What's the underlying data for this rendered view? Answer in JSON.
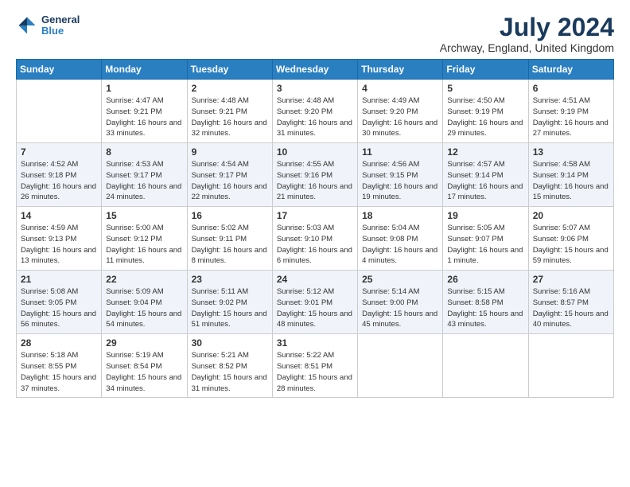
{
  "logo": {
    "line1": "General",
    "line2": "Blue"
  },
  "title": "July 2024",
  "subtitle": "Archway, England, United Kingdom",
  "weekdays": [
    "Sunday",
    "Monday",
    "Tuesday",
    "Wednesday",
    "Thursday",
    "Friday",
    "Saturday"
  ],
  "weeks": [
    [
      {
        "day": "",
        "sunrise": "",
        "sunset": "",
        "daylight": ""
      },
      {
        "day": "1",
        "sunrise": "Sunrise: 4:47 AM",
        "sunset": "Sunset: 9:21 PM",
        "daylight": "Daylight: 16 hours and 33 minutes."
      },
      {
        "day": "2",
        "sunrise": "Sunrise: 4:48 AM",
        "sunset": "Sunset: 9:21 PM",
        "daylight": "Daylight: 16 hours and 32 minutes."
      },
      {
        "day": "3",
        "sunrise": "Sunrise: 4:48 AM",
        "sunset": "Sunset: 9:20 PM",
        "daylight": "Daylight: 16 hours and 31 minutes."
      },
      {
        "day": "4",
        "sunrise": "Sunrise: 4:49 AM",
        "sunset": "Sunset: 9:20 PM",
        "daylight": "Daylight: 16 hours and 30 minutes."
      },
      {
        "day": "5",
        "sunrise": "Sunrise: 4:50 AM",
        "sunset": "Sunset: 9:19 PM",
        "daylight": "Daylight: 16 hours and 29 minutes."
      },
      {
        "day": "6",
        "sunrise": "Sunrise: 4:51 AM",
        "sunset": "Sunset: 9:19 PM",
        "daylight": "Daylight: 16 hours and 27 minutes."
      }
    ],
    [
      {
        "day": "7",
        "sunrise": "Sunrise: 4:52 AM",
        "sunset": "Sunset: 9:18 PM",
        "daylight": "Daylight: 16 hours and 26 minutes."
      },
      {
        "day": "8",
        "sunrise": "Sunrise: 4:53 AM",
        "sunset": "Sunset: 9:17 PM",
        "daylight": "Daylight: 16 hours and 24 minutes."
      },
      {
        "day": "9",
        "sunrise": "Sunrise: 4:54 AM",
        "sunset": "Sunset: 9:17 PM",
        "daylight": "Daylight: 16 hours and 22 minutes."
      },
      {
        "day": "10",
        "sunrise": "Sunrise: 4:55 AM",
        "sunset": "Sunset: 9:16 PM",
        "daylight": "Daylight: 16 hours and 21 minutes."
      },
      {
        "day": "11",
        "sunrise": "Sunrise: 4:56 AM",
        "sunset": "Sunset: 9:15 PM",
        "daylight": "Daylight: 16 hours and 19 minutes."
      },
      {
        "day": "12",
        "sunrise": "Sunrise: 4:57 AM",
        "sunset": "Sunset: 9:14 PM",
        "daylight": "Daylight: 16 hours and 17 minutes."
      },
      {
        "day": "13",
        "sunrise": "Sunrise: 4:58 AM",
        "sunset": "Sunset: 9:14 PM",
        "daylight": "Daylight: 16 hours and 15 minutes."
      }
    ],
    [
      {
        "day": "14",
        "sunrise": "Sunrise: 4:59 AM",
        "sunset": "Sunset: 9:13 PM",
        "daylight": "Daylight: 16 hours and 13 minutes."
      },
      {
        "day": "15",
        "sunrise": "Sunrise: 5:00 AM",
        "sunset": "Sunset: 9:12 PM",
        "daylight": "Daylight: 16 hours and 11 minutes."
      },
      {
        "day": "16",
        "sunrise": "Sunrise: 5:02 AM",
        "sunset": "Sunset: 9:11 PM",
        "daylight": "Daylight: 16 hours and 8 minutes."
      },
      {
        "day": "17",
        "sunrise": "Sunrise: 5:03 AM",
        "sunset": "Sunset: 9:10 PM",
        "daylight": "Daylight: 16 hours and 6 minutes."
      },
      {
        "day": "18",
        "sunrise": "Sunrise: 5:04 AM",
        "sunset": "Sunset: 9:08 PM",
        "daylight": "Daylight: 16 hours and 4 minutes."
      },
      {
        "day": "19",
        "sunrise": "Sunrise: 5:05 AM",
        "sunset": "Sunset: 9:07 PM",
        "daylight": "Daylight: 16 hours and 1 minute."
      },
      {
        "day": "20",
        "sunrise": "Sunrise: 5:07 AM",
        "sunset": "Sunset: 9:06 PM",
        "daylight": "Daylight: 15 hours and 59 minutes."
      }
    ],
    [
      {
        "day": "21",
        "sunrise": "Sunrise: 5:08 AM",
        "sunset": "Sunset: 9:05 PM",
        "daylight": "Daylight: 15 hours and 56 minutes."
      },
      {
        "day": "22",
        "sunrise": "Sunrise: 5:09 AM",
        "sunset": "Sunset: 9:04 PM",
        "daylight": "Daylight: 15 hours and 54 minutes."
      },
      {
        "day": "23",
        "sunrise": "Sunrise: 5:11 AM",
        "sunset": "Sunset: 9:02 PM",
        "daylight": "Daylight: 15 hours and 51 minutes."
      },
      {
        "day": "24",
        "sunrise": "Sunrise: 5:12 AM",
        "sunset": "Sunset: 9:01 PM",
        "daylight": "Daylight: 15 hours and 48 minutes."
      },
      {
        "day": "25",
        "sunrise": "Sunrise: 5:14 AM",
        "sunset": "Sunset: 9:00 PM",
        "daylight": "Daylight: 15 hours and 45 minutes."
      },
      {
        "day": "26",
        "sunrise": "Sunrise: 5:15 AM",
        "sunset": "Sunset: 8:58 PM",
        "daylight": "Daylight: 15 hours and 43 minutes."
      },
      {
        "day": "27",
        "sunrise": "Sunrise: 5:16 AM",
        "sunset": "Sunset: 8:57 PM",
        "daylight": "Daylight: 15 hours and 40 minutes."
      }
    ],
    [
      {
        "day": "28",
        "sunrise": "Sunrise: 5:18 AM",
        "sunset": "Sunset: 8:55 PM",
        "daylight": "Daylight: 15 hours and 37 minutes."
      },
      {
        "day": "29",
        "sunrise": "Sunrise: 5:19 AM",
        "sunset": "Sunset: 8:54 PM",
        "daylight": "Daylight: 15 hours and 34 minutes."
      },
      {
        "day": "30",
        "sunrise": "Sunrise: 5:21 AM",
        "sunset": "Sunset: 8:52 PM",
        "daylight": "Daylight: 15 hours and 31 minutes."
      },
      {
        "day": "31",
        "sunrise": "Sunrise: 5:22 AM",
        "sunset": "Sunset: 8:51 PM",
        "daylight": "Daylight: 15 hours and 28 minutes."
      },
      {
        "day": "",
        "sunrise": "",
        "sunset": "",
        "daylight": ""
      },
      {
        "day": "",
        "sunrise": "",
        "sunset": "",
        "daylight": ""
      },
      {
        "day": "",
        "sunrise": "",
        "sunset": "",
        "daylight": ""
      }
    ]
  ]
}
